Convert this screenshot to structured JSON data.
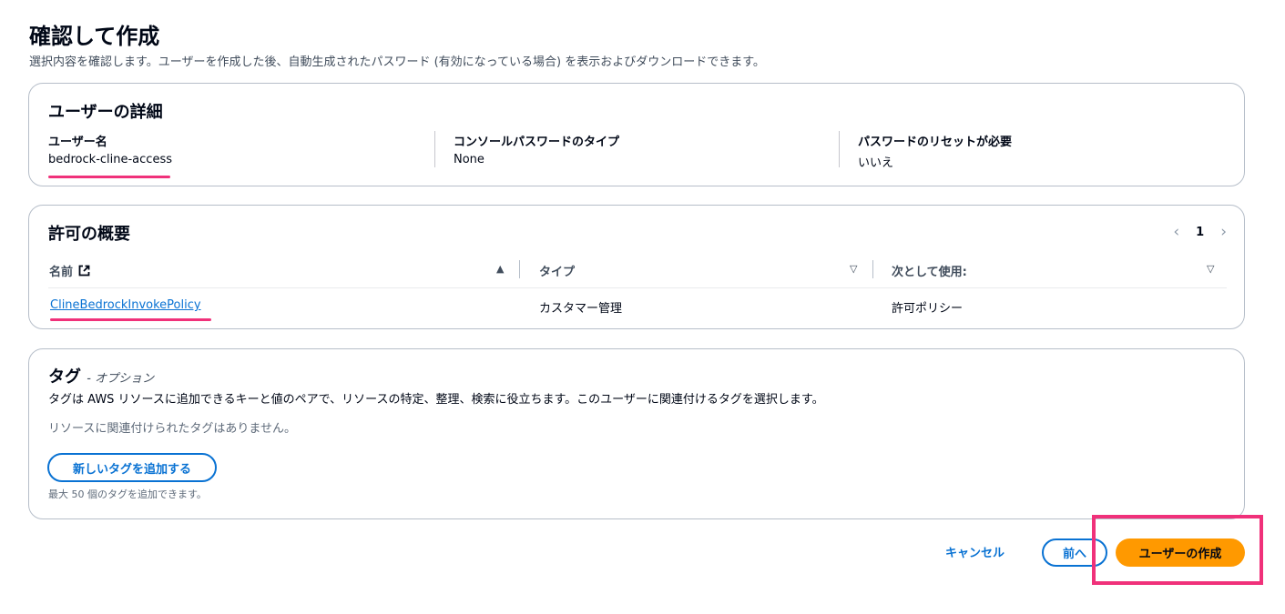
{
  "page": {
    "title": "確認して作成",
    "description": "選択内容を確認します。ユーザーを作成した後、自動生成されたパスワード (有効になっている場合) を表示およびダウンロードできます。"
  },
  "user_details": {
    "title": "ユーザーの詳細",
    "fields": [
      {
        "label": "ユーザー名",
        "value": "bedrock-cline-access"
      },
      {
        "label": "コンソールパスワードのタイプ",
        "value": "None"
      },
      {
        "label": "パスワードのリセットが必要",
        "value": "いいえ"
      }
    ]
  },
  "permissions": {
    "title": "許可の概要",
    "pager": {
      "prev": "‹",
      "page": "1",
      "next": "›"
    },
    "columns": [
      {
        "label": "名前",
        "sort": "▲"
      },
      {
        "label": "タイプ",
        "sort": "▽"
      },
      {
        "label": "次として使用:",
        "sort": "▽"
      }
    ],
    "rows": [
      {
        "name": "ClineBedrockInvokePolicy",
        "type": "カスタマー管理",
        "used_as": "許可ポリシー"
      }
    ]
  },
  "tags": {
    "title": "タグ",
    "optional": "- オプション",
    "description": "タグは AWS リソースに追加できるキーと値のペアで、リソースの特定、整理、検索に役立ちます。このユーザーに関連付けるタグを選択します。",
    "empty": "リソースに関連付けられたタグはありません。",
    "add_button": "新しいタグを追加する",
    "limit": "最大 50 個のタグを追加できます。"
  },
  "footer": {
    "cancel": "キャンセル",
    "previous": "前へ",
    "create": "ユーザーの作成"
  },
  "colors": {
    "link": "#0972d3",
    "primary": "#ff9900",
    "annotation": "#f0317a"
  }
}
